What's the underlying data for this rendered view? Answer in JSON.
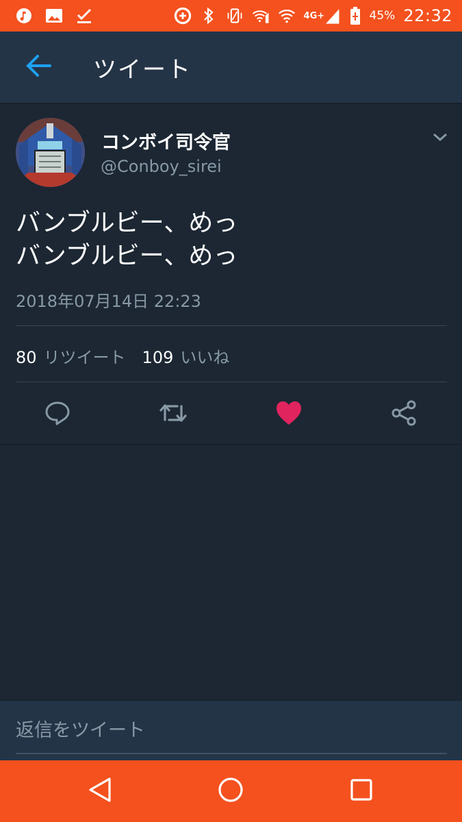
{
  "status_bar": {
    "battery_percent": "45%",
    "network": "4G+",
    "time": "22:32",
    "icons": [
      "music-note-icon",
      "image-icon",
      "download-done-icon",
      "data-saver-icon",
      "bluetooth-icon",
      "vibrate-icon",
      "wifi-calling-icon",
      "wifi-icon",
      "signal-icon",
      "battery-icon"
    ]
  },
  "header": {
    "title": "ツイート",
    "back_icon": "arrow-left-icon"
  },
  "tweet": {
    "user_name": "コンボイ司令官",
    "user_handle": "@Conboy_sirei",
    "text": "バンブルビー、めっ\nバンブルビー、めっ",
    "date": "2018年07月14日 22:23",
    "retweet_count": "80",
    "retweet_label": "リツイート",
    "like_count": "109",
    "like_label": "いいね",
    "liked": true
  },
  "actions": [
    "reply-icon",
    "retweet-icon",
    "like-icon",
    "share-icon"
  ],
  "reply": {
    "placeholder": "返信をツイート"
  },
  "colors": {
    "accent_orange": "#f4511e",
    "background": "#1c2733",
    "header_bg": "#243447",
    "link_blue": "#1da1f2",
    "like_red": "#e0245e",
    "muted_text": "#8899a6"
  }
}
